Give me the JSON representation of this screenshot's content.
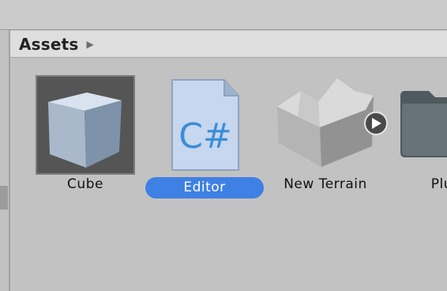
{
  "window": {
    "header_title": "Assets"
  },
  "breadcrumb": {
    "label": "Assets",
    "arrow_icon": "triangle-right-icon"
  },
  "assets": [
    {
      "label": "Cube",
      "icon": "cube-icon",
      "selected": false
    },
    {
      "label": "Editor",
      "icon": "csharp-script-icon",
      "selected": true
    },
    {
      "label": "New Terrain",
      "icon": "terrain-icon",
      "selected": false,
      "badge_icon": "play-icon"
    },
    {
      "label": "Plug",
      "icon": "folder-icon",
      "selected": false
    }
  ],
  "colors": {
    "selection": "#3f80e4",
    "background": "#c2c2c2",
    "breadcrumb_bg": "#dedede"
  }
}
